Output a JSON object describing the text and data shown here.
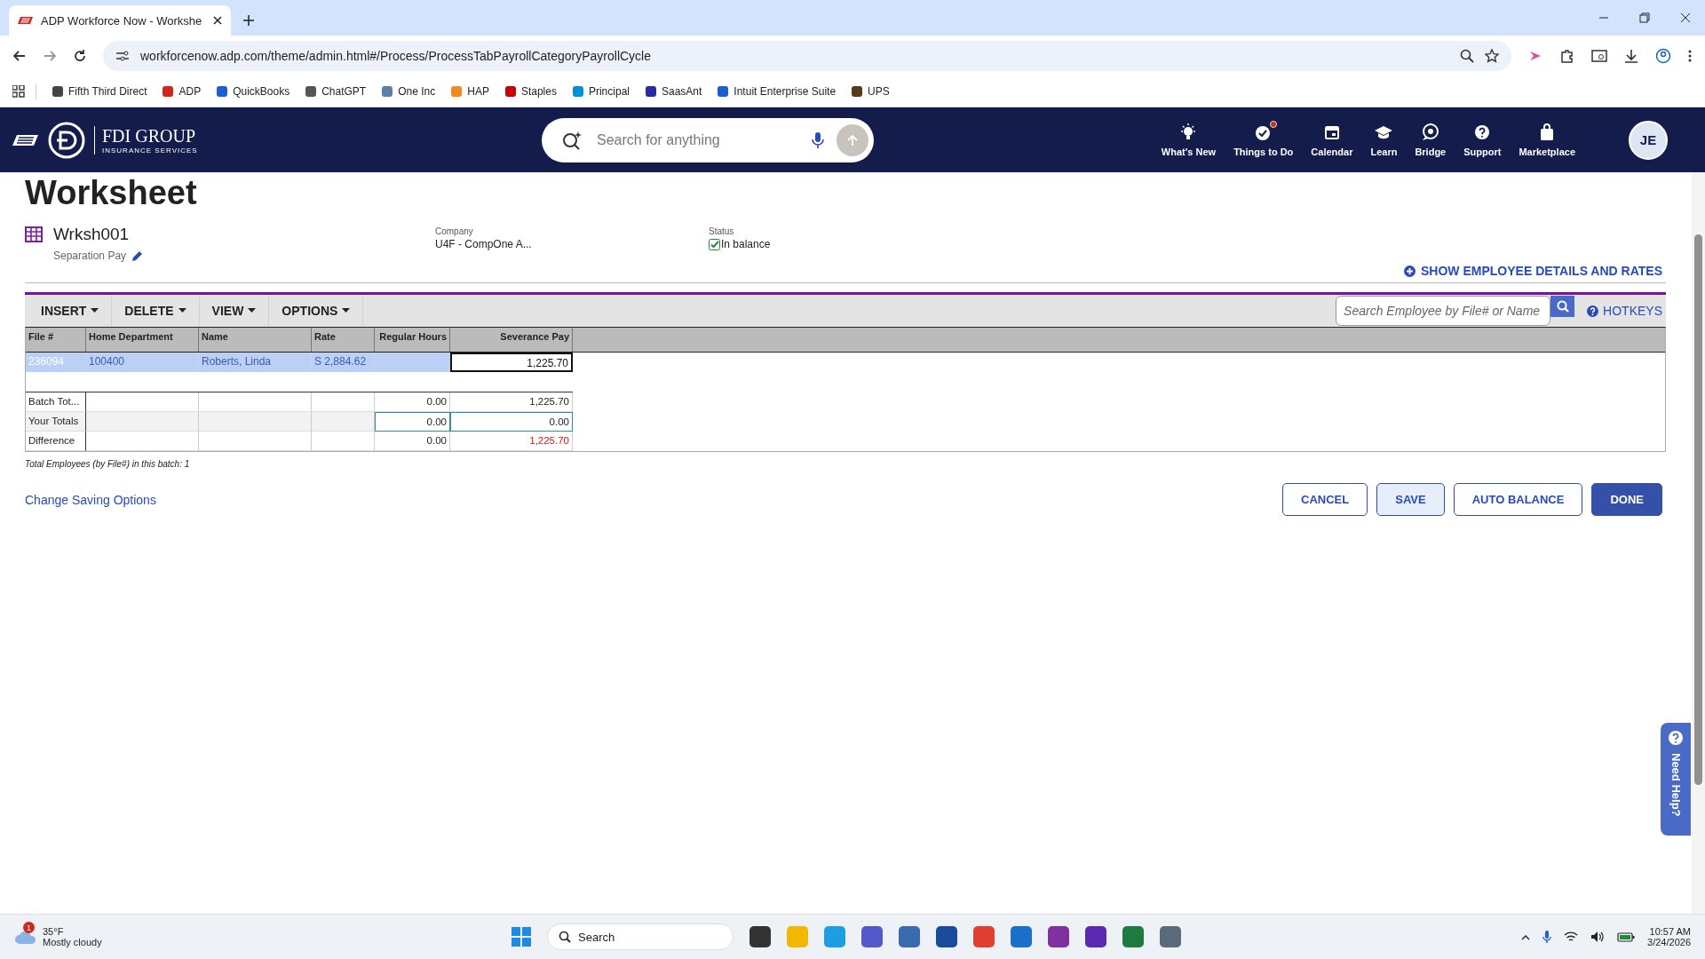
{
  "browser": {
    "tab_title": "ADP Workforce Now - Workshe",
    "url": "workforcenow.adp.com/theme/admin.html#/Process/ProcessTabPayrollCategoryPayrollCycle",
    "bookmarks": [
      {
        "label": "Fifth Third Direct",
        "color": "#444444"
      },
      {
        "label": "ADP",
        "color": "#d0271d"
      },
      {
        "label": "QuickBooks",
        "color": "#1a5fd0"
      },
      {
        "label": "ChatGPT",
        "color": "#555555"
      },
      {
        "label": "One Inc",
        "color": "#5a7fa8"
      },
      {
        "label": "HAP",
        "color": "#f08a24"
      },
      {
        "label": "Staples",
        "color": "#cc0000"
      },
      {
        "label": "Principal",
        "color": "#0091da"
      },
      {
        "label": "SaasAnt",
        "color": "#2a2aa8"
      },
      {
        "label": "Intuit Enterprise Suite",
        "color": "#1a5fd0"
      },
      {
        "label": "UPS",
        "color": "#5a3a1a"
      }
    ]
  },
  "header": {
    "brand": "FDI GROUP",
    "brand_sub": "INSURANCE SERVICES",
    "search_placeholder": "Search for anything",
    "nav": [
      {
        "label": "What's New",
        "badge": false
      },
      {
        "label": "Things to Do",
        "badge": true
      },
      {
        "label": "Calendar",
        "badge": false
      },
      {
        "label": "Learn",
        "badge": false
      },
      {
        "label": "Bridge",
        "badge": false
      },
      {
        "label": "Support",
        "badge": false
      },
      {
        "label": "Marketplace",
        "badge": false
      }
    ],
    "avatar": "JE"
  },
  "worksheet": {
    "title": "Worksheet",
    "batch": "Wrksh001",
    "description": "Separation Pay",
    "company_label": "Company",
    "company": "U4F - CompOne A...",
    "status_label": "Status",
    "status": "In balance",
    "balanced": true,
    "show_details": "SHOW EMPLOYEE DETAILS AND RATES",
    "menus": [
      "INSERT",
      "DELETE",
      "VIEW",
      "OPTIONS"
    ],
    "search_placeholder": "Search Employee by File# or Name",
    "hotkeys": "HOTKEYS",
    "columns": [
      "File #",
      "Home Department",
      "Name",
      "Rate",
      "Regular Hours",
      "Severance Pay"
    ],
    "rows": [
      {
        "selected": true,
        "cells": [
          "236094",
          "100400",
          "Roberts, Linda",
          "S 2,884.62",
          "",
          "1,225.70"
        ]
      }
    ],
    "totals": [
      {
        "kind": "plain",
        "label": "Batch Tot...",
        "regular_hours": "0.00",
        "severance_pay": "1,225.70"
      },
      {
        "kind": "input",
        "label": "Your Totals",
        "regular_hours": "0.00",
        "severance_pay": "0.00"
      },
      {
        "kind": "difference",
        "label": "Difference",
        "regular_hours": "0.00",
        "severance_pay": "1,225.70"
      }
    ],
    "note": "Total Employees (by File#) in this batch: 1",
    "saving_options": "Change Saving Options",
    "buttons": [
      {
        "label": "CANCEL",
        "kind": "outline"
      },
      {
        "label": "SAVE",
        "kind": "soft"
      },
      {
        "label": "AUTO BALANCE",
        "kind": "outline"
      },
      {
        "label": "DONE",
        "kind": "primary"
      }
    ],
    "need_help": "Need Help?"
  },
  "taskbar": {
    "temperature": "35°F",
    "weather": "Mostly cloudy",
    "weather_badge": "1",
    "search_placeholder": "Search",
    "time": "10:57 AM",
    "date": "3/24/2026",
    "apps": [
      {
        "color": "#333333"
      },
      {
        "color": "#f2b800"
      },
      {
        "color": "#1e9de0"
      },
      {
        "color": "#5558c8"
      },
      {
        "color": "#3a6ab0"
      },
      {
        "color": "#1a4a9a"
      },
      {
        "color": "#e04030"
      },
      {
        "color": "#1a70c8"
      },
      {
        "color": "#8030a0"
      },
      {
        "color": "#5a2ab0"
      },
      {
        "color": "#1e7a3e"
      },
      {
        "color": "#5a6a7a"
      }
    ]
  }
}
